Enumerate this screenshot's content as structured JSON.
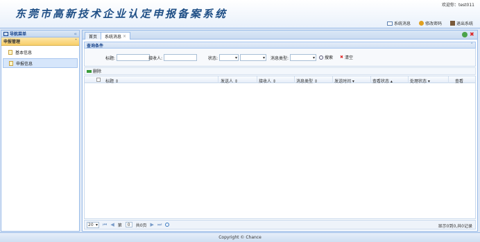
{
  "header": {
    "title": "东莞市高新技术企业认定申报备案系统",
    "welcome": "欢迎你：test011",
    "links": [
      {
        "label": "系统消息",
        "icon": "message-icon"
      },
      {
        "label": "修改密码",
        "icon": "key-icon"
      },
      {
        "label": "退出系统",
        "icon": "exit-icon"
      }
    ]
  },
  "sidebar": {
    "title": "导航菜单",
    "collapse_glyph": "«",
    "group": "申报管理",
    "group_glyph": "˄",
    "items": [
      {
        "label": "基本信息"
      },
      {
        "label": "申报信息"
      }
    ]
  },
  "tabs": {
    "home": "首页",
    "active": "系统消息",
    "close_glyph": "×"
  },
  "query": {
    "title": "查询条件",
    "collapse_glyph": "˄",
    "title_label": "标题:",
    "receiver_label": "接收人:",
    "status_label": "状态:",
    "type_label": "消息类型:",
    "search_label": "搜索",
    "clear_label": "清空"
  },
  "grid": {
    "delete_label": "删除",
    "columns": [
      "标题",
      "发送人",
      "接收人",
      "消息类型",
      "发送时间",
      "查看状态",
      "处理状态",
      "查看"
    ],
    "rows": []
  },
  "pager": {
    "page_size": "20",
    "page_prefix": "第",
    "page_value": "0",
    "page_suffix": "共0页",
    "info": "显示0到0,共0记录"
  },
  "footer": {
    "copyright": "Copyright © Chance"
  },
  "colors": {
    "accent": "#15428b",
    "border": "#99bbe8",
    "group_header": "#f8cf6a"
  }
}
